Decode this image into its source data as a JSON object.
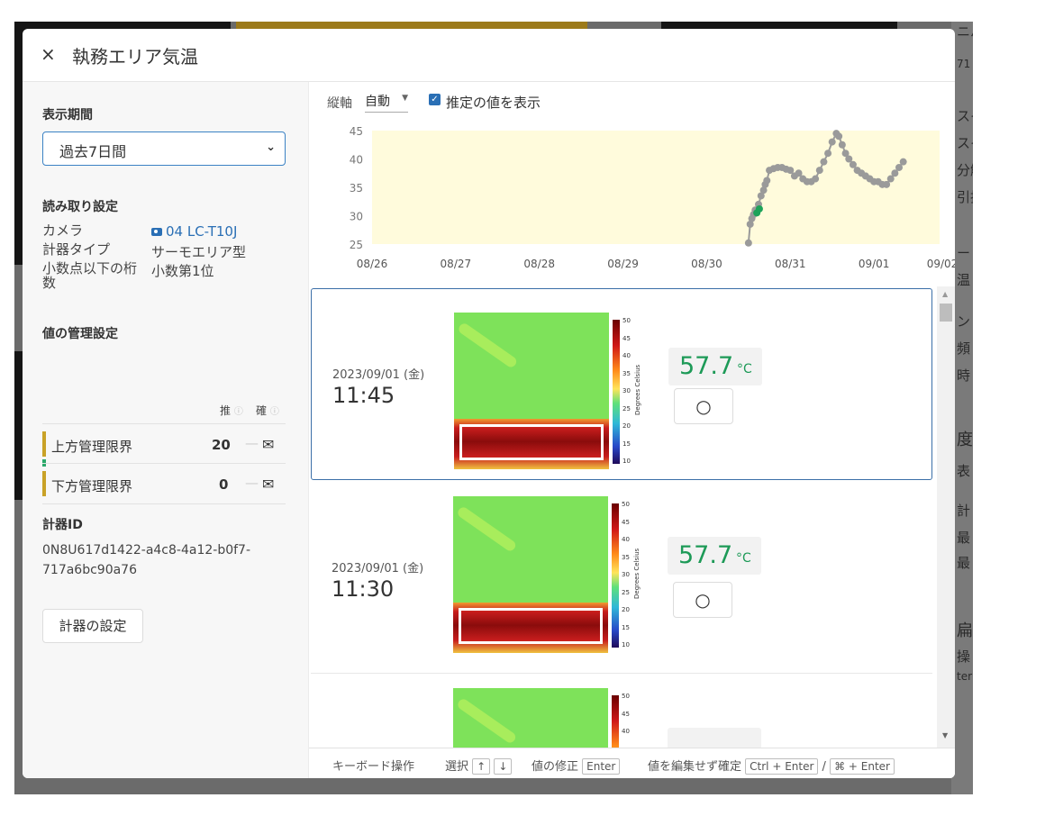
{
  "dialog": {
    "title": "執務エリア気温",
    "close_icon": "×"
  },
  "display_period": {
    "heading": "表示期間",
    "selected": "過去7日間"
  },
  "read_settings": {
    "heading": "読み取り設定",
    "camera_label": "カメラ",
    "camera_value": "04 LC-T10J",
    "meter_type_label": "計器タイプ",
    "meter_type_value": "サーモエリア型",
    "decimal_label_1": "小数点以下の桁",
    "decimal_label_2": "数",
    "decimal_value": "小数第1位"
  },
  "value_mgmt": {
    "heading": "値の管理設定",
    "col_estimate": "推",
    "col_confirm": "確",
    "upper_label": "上方管理限界",
    "upper_value": "20",
    "lower_label": "下方管理限界",
    "lower_value": "0",
    "dash": "—",
    "status_icon": "mail-check-icon"
  },
  "meter_id": {
    "heading": "計器ID",
    "value": "0N8U617d1422-a4c8-4a12-b0f7-717a6bc90a76"
  },
  "settings_button": "計器の設定",
  "chart_controls": {
    "axis_label": "縦軸",
    "axis_value": "自動",
    "show_estimate_label": "推定の値を表示",
    "show_estimate_checked": true
  },
  "chart_data": {
    "type": "scatter",
    "title": "",
    "xlabel": "",
    "ylabel": "",
    "x_ticks": [
      "08/26",
      "08/27",
      "08/28",
      "08/29",
      "08/30",
      "08/31",
      "09/01",
      "09/02"
    ],
    "y_ticks": [
      25,
      30,
      35,
      40,
      45
    ],
    "ylim": [
      25,
      45
    ],
    "grid": false,
    "background": "#fffbdc",
    "series": [
      {
        "color": "#9a9a9a",
        "points": [
          [
            4.5,
            25.2
          ],
          [
            4.52,
            28.5
          ],
          [
            4.54,
            29.5
          ],
          [
            4.56,
            30.2
          ],
          [
            4.58,
            31
          ],
          [
            4.62,
            32
          ],
          [
            4.65,
            33.5
          ],
          [
            4.68,
            34.5
          ],
          [
            4.7,
            35.5
          ],
          [
            4.72,
            36.2
          ],
          [
            4.75,
            38
          ],
          [
            4.8,
            38.3
          ],
          [
            4.85,
            38.5
          ],
          [
            4.9,
            38.5
          ],
          [
            4.95,
            38.2
          ],
          [
            5.0,
            38
          ],
          [
            5.05,
            37
          ],
          [
            5.1,
            37.5
          ],
          [
            5.15,
            36.5
          ],
          [
            5.2,
            36
          ],
          [
            5.25,
            36
          ],
          [
            5.3,
            36.5
          ],
          [
            5.35,
            38
          ],
          [
            5.4,
            39.5
          ],
          [
            5.45,
            41
          ],
          [
            5.5,
            43
          ],
          [
            5.55,
            44.5
          ],
          [
            5.58,
            44
          ],
          [
            5.62,
            42.5
          ],
          [
            5.66,
            41
          ],
          [
            5.7,
            40
          ],
          [
            5.75,
            39
          ],
          [
            5.8,
            38
          ],
          [
            5.85,
            37.5
          ],
          [
            5.9,
            37
          ],
          [
            5.95,
            36.5
          ],
          [
            6.0,
            36
          ],
          [
            6.05,
            36
          ],
          [
            6.1,
            35.5
          ],
          [
            6.15,
            35.5
          ],
          [
            6.2,
            36.5
          ],
          [
            6.25,
            37.5
          ],
          [
            6.3,
            38.5
          ],
          [
            6.35,
            39.5
          ]
        ]
      },
      {
        "color": "#1da359",
        "points": [
          [
            4.6,
            30.5
          ],
          [
            4.63,
            31.2
          ]
        ]
      }
    ]
  },
  "readings": [
    {
      "date": "2023/09/01 (金)",
      "time": "11:45",
      "value": "57.7",
      "unit": "°C",
      "mark": "○"
    },
    {
      "date": "2023/09/01 (金)",
      "time": "11:30",
      "value": "57.7",
      "unit": "°C",
      "mark": "○"
    }
  ],
  "colorbar": {
    "title": "Degrees Celsius",
    "ticks": [
      "50",
      "45",
      "40",
      "35",
      "30",
      "25",
      "20",
      "15",
      "10"
    ]
  },
  "keyboard_bar": {
    "label": "キーボード操作",
    "select_label": "選択",
    "up_key": "↑",
    "down_key": "↓",
    "fix_label": "値の修正",
    "enter_key": "Enter",
    "confirm_label": "値を編集せず確定",
    "ctrl_enter": "Ctrl + Enter",
    "slash": "/",
    "cmd_enter": "⌘ + Enter"
  },
  "background_fragments": [
    "ニバ",
    "71",
    "スイ",
    "スイ",
    "分解",
    "引抜",
    "ー",
    "温",
    "ン",
    "頻",
    "時",
    "度か",
    "表",
    "計",
    "最",
    "最",
    "扁",
    "操",
    "ter"
  ]
}
